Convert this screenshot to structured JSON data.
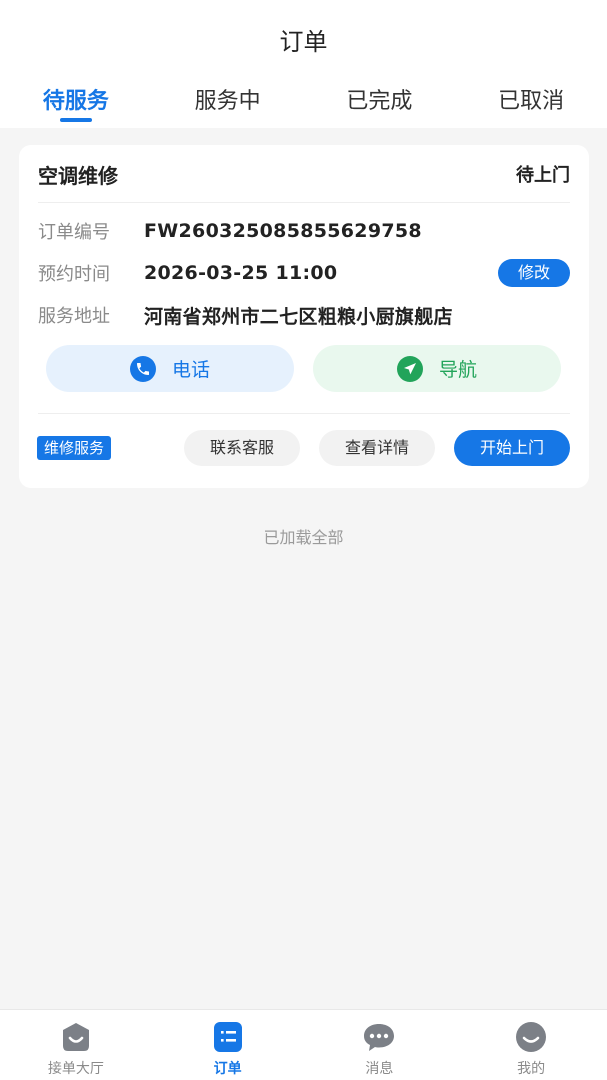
{
  "header": {
    "title": "订单"
  },
  "tabs": [
    {
      "label": "待服务",
      "active": true
    },
    {
      "label": "服务中",
      "active": false
    },
    {
      "label": "已完成",
      "active": false
    },
    {
      "label": "已取消",
      "active": false
    }
  ],
  "order": {
    "service_name": "空调维修",
    "status": "待上门",
    "fields": [
      {
        "label": "订单编号",
        "value": "FW260325085855629758"
      },
      {
        "label": "预约时间",
        "value": "2026-03-25 11:00"
      },
      {
        "label": "服务地址",
        "value": "河南省郑州市二七区粗粮小厨旗舰店"
      }
    ],
    "modify_label": "修改",
    "phone_label": "电话",
    "navigate_label": "导航",
    "service_tag": "维修服务",
    "contact_label": "联系客服",
    "details_label": "查看详情",
    "start_label": "开始上门"
  },
  "list_footer": "已加载全部",
  "bottom_nav": [
    {
      "label": "接单大厅",
      "icon": "hall-icon",
      "active": false
    },
    {
      "label": "订单",
      "icon": "order-list-icon",
      "active": true
    },
    {
      "label": "消息",
      "icon": "message-icon",
      "active": false
    },
    {
      "label": "我的",
      "icon": "profile-icon",
      "active": false
    }
  ],
  "colors": {
    "primary": "#1677e6",
    "success": "#22a45a",
    "background": "#f5f5f5",
    "nav_icon_grey": "#7c8087"
  }
}
